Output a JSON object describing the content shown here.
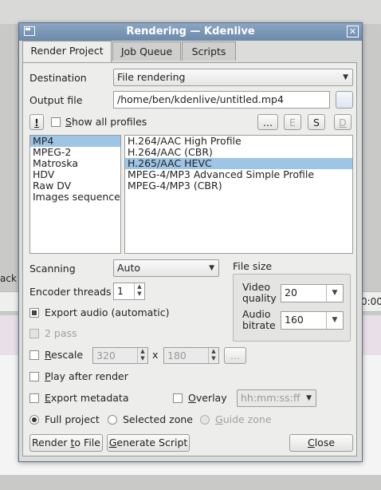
{
  "background": {
    "left_label": "ack",
    "right_label": "0:00"
  },
  "window": {
    "title": "Rendering — Kdenlive"
  },
  "tabs": [
    {
      "label": "Render Project"
    },
    {
      "label": "Job Queue"
    },
    {
      "label": "Scripts"
    }
  ],
  "destination": {
    "label": "Destination",
    "value": "File rendering"
  },
  "output": {
    "label": "Output file",
    "value": "/home/ben/kdenlive/untitled.mp4"
  },
  "profiles": {
    "info_button": "!",
    "show_all_label": "Show all profiles",
    "more_button": "...",
    "edit_button": "E",
    "save_button": "S",
    "delete_button": "D"
  },
  "formats": [
    "MP4",
    "MPEG-2",
    "Matroska",
    "HDV",
    "Raw DV",
    "Images sequence"
  ],
  "formats_selected": "MP4",
  "codecs": [
    "H.264/AAC High Profile",
    "H.264/AAC (CBR)",
    "H.265/AAC HEVC",
    "MPEG-4/MP3 Advanced Simple Profile",
    "MPEG-4/MP3 (CBR)"
  ],
  "codecs_selected": "H.265/AAC HEVC",
  "scanning": {
    "label": "Scanning",
    "value": "Auto"
  },
  "encoder_threads": {
    "label": "Encoder threads",
    "value": "1"
  },
  "export_audio": {
    "label": "Export audio (automatic)"
  },
  "two_pass": {
    "label": "2 pass"
  },
  "file_size": {
    "label": "File size",
    "video_quality_label1": "Video",
    "video_quality_label2": "quality",
    "video_quality": "20",
    "audio_bitrate_label1": "Audio",
    "audio_bitrate_label2": "bitrate",
    "audio_bitrate": "160"
  },
  "rescale": {
    "label": "Rescale",
    "width": "320",
    "x": "x",
    "height": "180",
    "more": "..."
  },
  "play_after": {
    "label": "Play after render"
  },
  "export_metadata": {
    "label": "Export metadata"
  },
  "overlay": {
    "label": "Overlay",
    "value": "hh:mm:ss:ff"
  },
  "zones": {
    "full": "Full project",
    "selected": "Selected zone",
    "guide": "Guide zone"
  },
  "buttons": {
    "render": "Render to File",
    "script": "Generate Script",
    "close": "Close"
  }
}
